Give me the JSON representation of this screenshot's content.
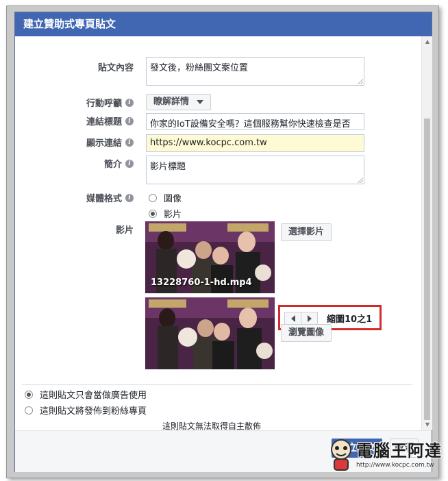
{
  "dialog": {
    "title": "建立贊助式專頁貼文"
  },
  "form": {
    "post_content": {
      "label": "貼文內容",
      "value": "發文後，粉絲團文案位置"
    },
    "cta": {
      "label": "行動呼籲",
      "value": "瞭解詳情"
    },
    "link_title": {
      "label": "連結標題",
      "value": "你家的IoT設備安全嗎？這個服務幫你快速檢查是否"
    },
    "display_link": {
      "label": "顯示連結",
      "value": "https://www.kocpc.com.tw"
    },
    "description": {
      "label": "簡介",
      "value": "影片標題"
    },
    "media_format": {
      "label": "媒體格式",
      "options": [
        "圖像",
        "影片"
      ],
      "selected": "影片"
    },
    "video": {
      "label": "影片",
      "filename": "13228760-1-hd.mp4",
      "choose_button": "選擇影片",
      "thumbnail_counter": "縮圖10之1",
      "browse_button": "瀏覽圖像"
    }
  },
  "publish_options": {
    "items": [
      "這則貼文只會當做廣告使用",
      "這則貼文將發佈到粉絲專頁"
    ],
    "selected_index": 0,
    "note": "這則貼文無法取得自主散佈"
  },
  "footer": {
    "create_button": "建立貼文",
    "cancel_button": "取消"
  },
  "watermark": {
    "text": "電腦王阿達",
    "url": "http://www.kocpc.com.tw"
  },
  "colors": {
    "title_bar": "#4267b2",
    "highlight_box": "#d02b2b",
    "display_link_bg": "#fefbd4"
  }
}
